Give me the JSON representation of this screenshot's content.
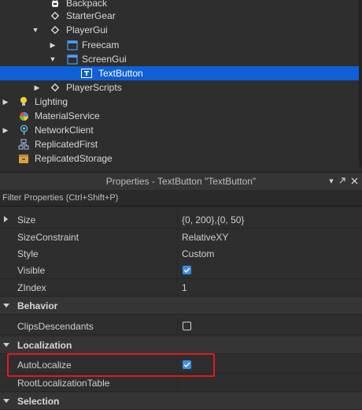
{
  "explorer": {
    "items": [
      {
        "label": "Backpack",
        "icon": "backpack-icon"
      },
      {
        "label": "StarterGear",
        "icon": "starter-gear-icon"
      },
      {
        "label": "PlayerGui",
        "icon": "player-gui-icon",
        "expanded": true
      },
      {
        "label": "Freecam",
        "icon": "freecam-icon",
        "collapsed": true
      },
      {
        "label": "ScreenGui",
        "icon": "screengui-icon",
        "expanded": true
      },
      {
        "label": "TextButton",
        "icon": "textbutton-icon",
        "selected": true
      },
      {
        "label": "PlayerScripts",
        "icon": "player-scripts-icon",
        "collapsed": true
      },
      {
        "label": "Lighting",
        "icon": "lighting-icon",
        "collapsed": true
      },
      {
        "label": "MaterialService",
        "icon": "material-service-icon"
      },
      {
        "label": "NetworkClient",
        "icon": "network-client-icon",
        "collapsed": true
      },
      {
        "label": "ReplicatedFirst",
        "icon": "replicated-first-icon"
      },
      {
        "label": "ReplicatedStorage",
        "icon": "replicated-storage-icon"
      }
    ]
  },
  "properties": {
    "title": "Properties - TextButton \"TextButton\"",
    "filter_placeholder": "Filter Properties (Ctrl+Shift+P)",
    "header_buttons": {
      "dropdown": "chevron-down-icon",
      "popout": "popout-icon",
      "close": "close-icon"
    },
    "rows": [
      {
        "name": "Size",
        "value": "{0, 200},{0, 50}",
        "collapsed": true
      },
      {
        "name": "SizeConstraint",
        "value": "RelativeXY"
      },
      {
        "name": "Style",
        "value": "Custom"
      },
      {
        "name": "Visible",
        "checkbox": true
      },
      {
        "name": "ZIndex",
        "value": "1"
      },
      {
        "name": "Behavior",
        "category": true
      },
      {
        "name": "ClipsDescendants",
        "checkbox": false
      },
      {
        "name": "Localization",
        "category": true
      },
      {
        "name": "AutoLocalize",
        "checkbox": true,
        "highlighted": true
      },
      {
        "name": "RootLocalizationTable",
        "value": ""
      },
      {
        "name": "Selection",
        "category": true
      }
    ]
  },
  "colors": {
    "selection": "#0f5fd6",
    "checkbox_on": "#3a90e8",
    "highlight_box": "#e11b1b"
  }
}
